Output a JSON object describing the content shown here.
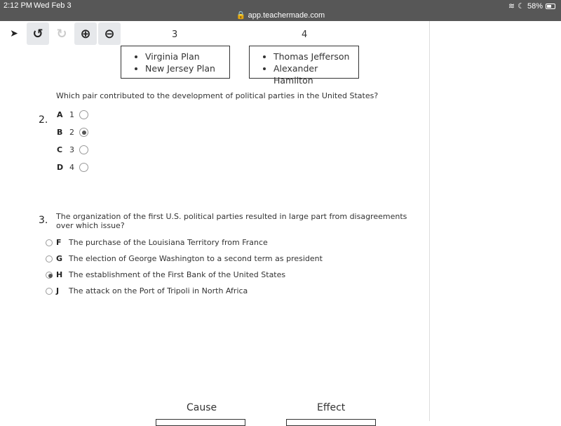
{
  "status": {
    "time": "2:12 PM",
    "date": "Wed Feb 3",
    "url": "app.teachermade.com",
    "battery": "58%"
  },
  "toolbar": {
    "items": [
      "pointer",
      "undo",
      "redo",
      "zoom-in",
      "zoom-out"
    ]
  },
  "columns": [
    {
      "num": "3",
      "items": [
        "Virginia Plan",
        "New Jersey Plan"
      ]
    },
    {
      "num": "4",
      "items": [
        "Thomas Jefferson",
        "Alexander Hamilton"
      ]
    }
  ],
  "q2": {
    "number": "2.",
    "text": "Which pair contributed to the development of political parties in the United States?",
    "options": [
      {
        "letter": "A",
        "value": "1",
        "selected": false
      },
      {
        "letter": "B",
        "value": "2",
        "selected": true
      },
      {
        "letter": "C",
        "value": "3",
        "selected": false
      },
      {
        "letter": "D",
        "value": "4",
        "selected": false
      }
    ]
  },
  "q3": {
    "number": "3.",
    "text1": "The organization of the first U.S. political parties resulted in large part from disagreements",
    "text2": "over which issue?",
    "options": [
      {
        "letter": "F",
        "value": "The purchase of the Louisiana Territory from France",
        "selected": false
      },
      {
        "letter": "G",
        "value": "The election of George Washington to a second term as president",
        "selected": false
      },
      {
        "letter": "H",
        "value": "The establishment of the First Bank of the United States",
        "selected": true
      },
      {
        "letter": "J",
        "value": "The attack on the Port of Tripoli in North Africa",
        "selected": false
      }
    ]
  },
  "table": {
    "cause": "Cause",
    "effect": "Effect"
  }
}
